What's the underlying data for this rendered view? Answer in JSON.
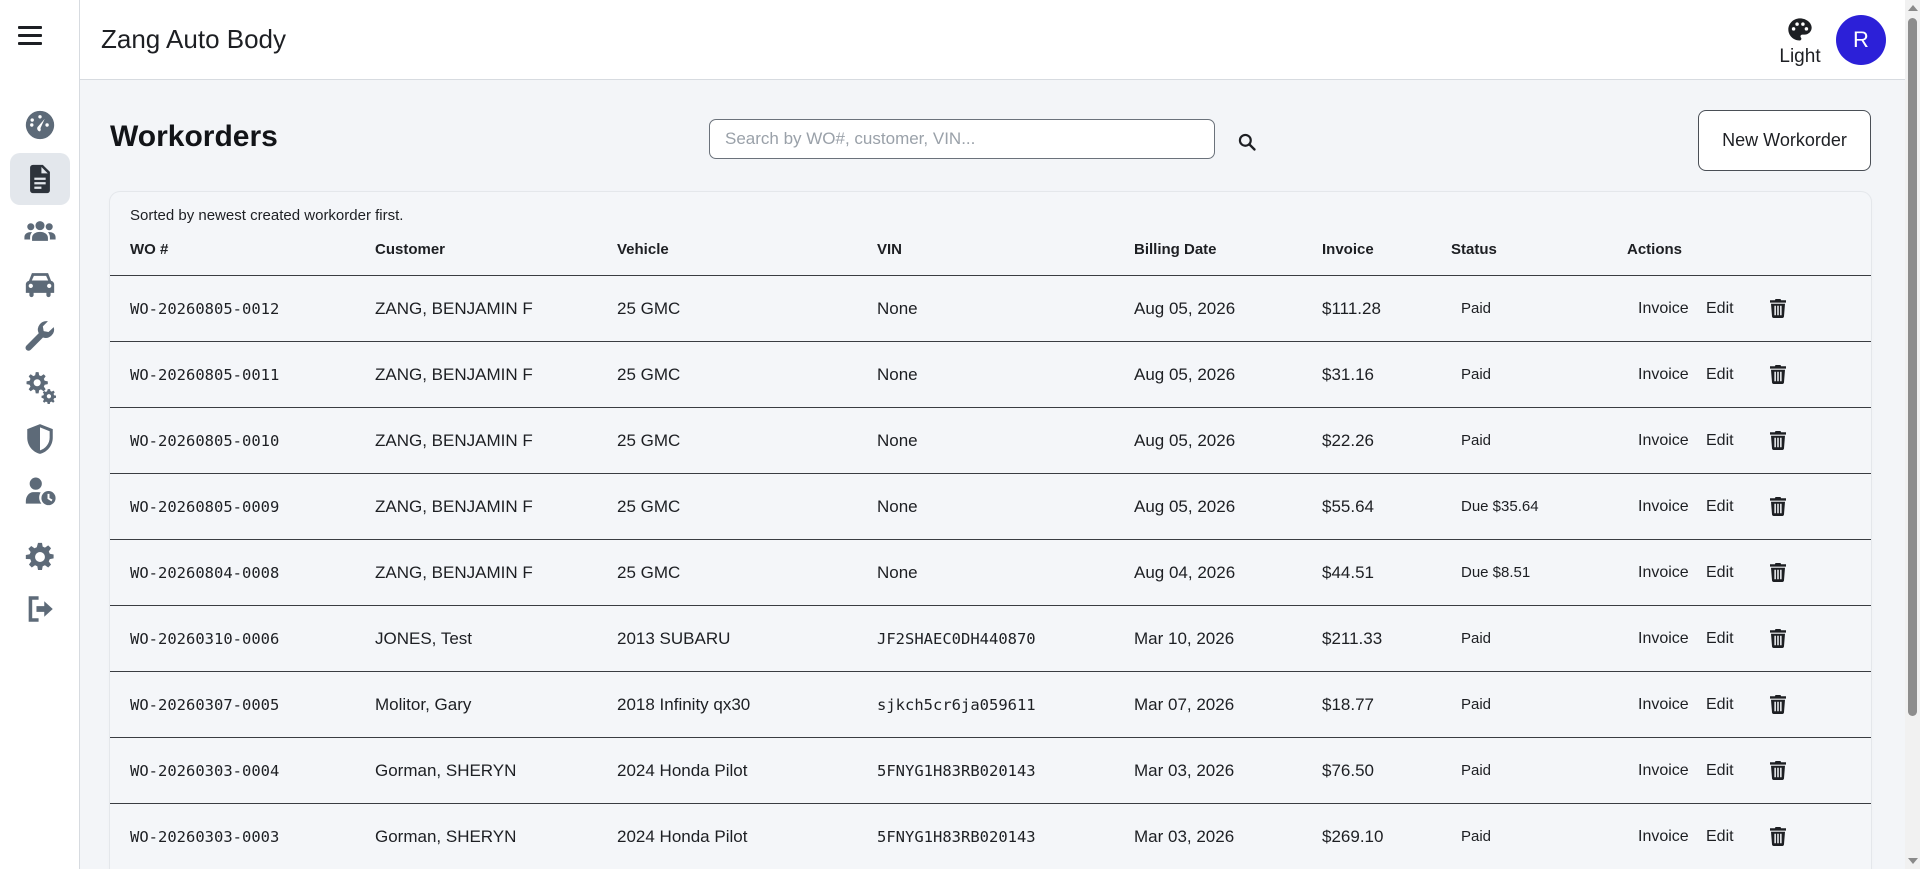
{
  "app": {
    "title": "Zang Auto Body"
  },
  "user": {
    "initial": "R",
    "avatar_color": "#2c20d8"
  },
  "theme": {
    "label": "Light"
  },
  "sidebar": {
    "items": [
      {
        "icon": "dashboard-gauge-icon",
        "active": false
      },
      {
        "icon": "workorders-document-icon",
        "active": true
      },
      {
        "icon": "customers-users-icon",
        "active": false
      },
      {
        "icon": "vehicles-car-icon",
        "active": false
      },
      {
        "icon": "services-wrench-icon",
        "active": false
      },
      {
        "icon": "settings-gears-icon",
        "active": false
      },
      {
        "icon": "security-shield-icon",
        "active": false
      },
      {
        "icon": "user-clock-icon",
        "active": false
      },
      {
        "icon": "settings-gear-icon",
        "active": false
      },
      {
        "icon": "logout-icon",
        "active": false
      }
    ]
  },
  "page": {
    "title": "Workorders",
    "search_placeholder": "Search by WO#, customer, VIN...",
    "new_button": "New Workorder",
    "sort_note": "Sorted by newest created workorder first."
  },
  "table": {
    "columns": [
      "WO #",
      "Customer",
      "Vehicle",
      "VIN",
      "Billing Date",
      "Invoice",
      "Status",
      "Actions"
    ],
    "action_labels": {
      "invoice": "Invoice",
      "edit": "Edit"
    },
    "rows": [
      {
        "wo": "WO-20260805-0012",
        "customer": "ZANG, BENJAMIN F",
        "vehicle": "25 GMC",
        "vin": "None",
        "billing_date": "Aug 05, 2026",
        "invoice": "$111.28",
        "status": "Paid"
      },
      {
        "wo": "WO-20260805-0011",
        "customer": "ZANG, BENJAMIN F",
        "vehicle": "25 GMC",
        "vin": "None",
        "billing_date": "Aug 05, 2026",
        "invoice": "$31.16",
        "status": "Paid"
      },
      {
        "wo": "WO-20260805-0010",
        "customer": "ZANG, BENJAMIN F",
        "vehicle": "25 GMC",
        "vin": "None",
        "billing_date": "Aug 05, 2026",
        "invoice": "$22.26",
        "status": "Paid"
      },
      {
        "wo": "WO-20260805-0009",
        "customer": "ZANG, BENJAMIN F",
        "vehicle": "25 GMC",
        "vin": "None",
        "billing_date": "Aug 05, 2026",
        "invoice": "$55.64",
        "status": "Due $35.64"
      },
      {
        "wo": "WO-20260804-0008",
        "customer": "ZANG, BENJAMIN F",
        "vehicle": "25 GMC",
        "vin": "None",
        "billing_date": "Aug 04, 2026",
        "invoice": "$44.51",
        "status": "Due $8.51"
      },
      {
        "wo": "WO-20260310-0006",
        "customer": "JONES, Test",
        "vehicle": "2013 SUBARU",
        "vin": "JF2SHAEC0DH440870",
        "billing_date": "Mar 10, 2026",
        "invoice": "$211.33",
        "status": "Paid"
      },
      {
        "wo": "WO-20260307-0005",
        "customer": "Molitor, Gary",
        "vehicle": "2018 Infinity qx30",
        "vin": "sjkch5cr6ja059611",
        "billing_date": "Mar 07, 2026",
        "invoice": "$18.77",
        "status": "Paid"
      },
      {
        "wo": "WO-20260303-0004",
        "customer": "Gorman, SHERYN",
        "vehicle": "2024 Honda Pilot",
        "vin": "5FNYG1H83RB020143",
        "billing_date": "Mar 03, 2026",
        "invoice": "$76.50",
        "status": "Paid"
      },
      {
        "wo": "WO-20260303-0003",
        "customer": "Gorman, SHERYN",
        "vehicle": "2024 Honda Pilot",
        "vin": "5FNYG1H83RB020143",
        "billing_date": "Mar 03, 2026",
        "invoice": "$269.10",
        "status": "Paid"
      }
    ]
  }
}
